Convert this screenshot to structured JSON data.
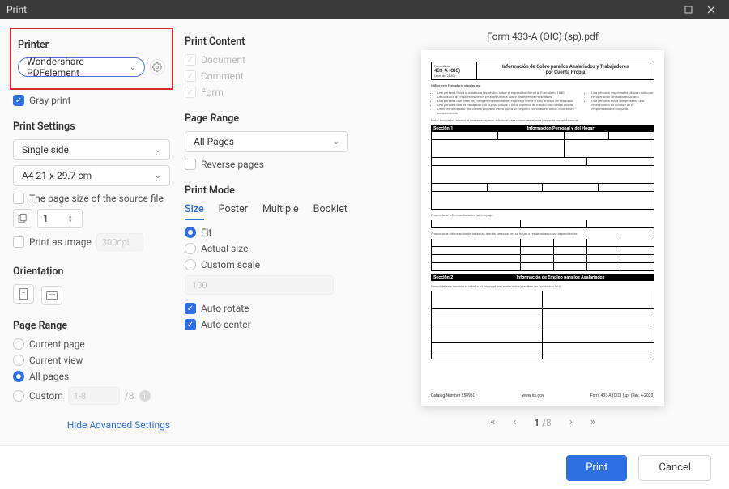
{
  "window": {
    "title": "Print"
  },
  "printer": {
    "title": "Printer",
    "selected": "Wondershare PDFelement",
    "gray_print_label": "Gray print",
    "gray_print_checked": true
  },
  "print_settings": {
    "title": "Print Settings",
    "duplex": "Single side",
    "paper": "A4 21 x 29.7 cm",
    "source_size_label": "The page size of the source file",
    "copies_value": "1",
    "print_as_image_label": "Print as image",
    "dpi_placeholder": "300dpi"
  },
  "orientation": {
    "title": "Orientation"
  },
  "page_range_left": {
    "title": "Page Range",
    "options": {
      "current_page": "Current page",
      "current_view": "Current view",
      "all_pages": "All pages",
      "custom": "Custom"
    },
    "custom_placeholder": "1-8",
    "total_suffix": "/8"
  },
  "advanced_link": "Hide Advanced Settings",
  "print_content": {
    "title": "Print Content",
    "items": {
      "document": "Document",
      "comment": "Comment",
      "form": "Form"
    }
  },
  "page_range_mid": {
    "title": "Page Range",
    "selected": "All Pages",
    "reverse_label": "Reverse pages"
  },
  "print_mode": {
    "title": "Print Mode",
    "tabs": {
      "size": "Size",
      "poster": "Poster",
      "multiple": "Multiple",
      "booklet": "Booklet"
    },
    "fit": "Fit",
    "actual": "Actual size",
    "custom_scale": "Custom scale",
    "scale_placeholder": "100",
    "auto_rotate": "Auto rotate",
    "auto_center": "Auto center"
  },
  "preview": {
    "filename": "Form 433-A (OIC) (sp).pdf",
    "form_number": "433-A (OIC)",
    "form_date": "(abril de 2020)",
    "form_prefix": "Formulario",
    "form_title_1": "Información de Cobro para los Asalariados y Trabajadores",
    "form_title_2": "por Cuenta Propia",
    "intro_head": "Utilice este formulario si usted es:",
    "section1": "Sección 1",
    "section1_title": "Información Personal y del Hogar",
    "section2": "Sección 2",
    "section2_title": "Información de Empleo para los Asalariados",
    "footer_left": "Catalog Number 55896Q",
    "footer_mid": "www.irs.gov",
    "footer_right": "Form 433-A (OIC) (sp) (Rev. 4-2020)"
  },
  "pager": {
    "current": "1",
    "total": "/8"
  },
  "buttons": {
    "print": "Print",
    "cancel": "Cancel"
  }
}
